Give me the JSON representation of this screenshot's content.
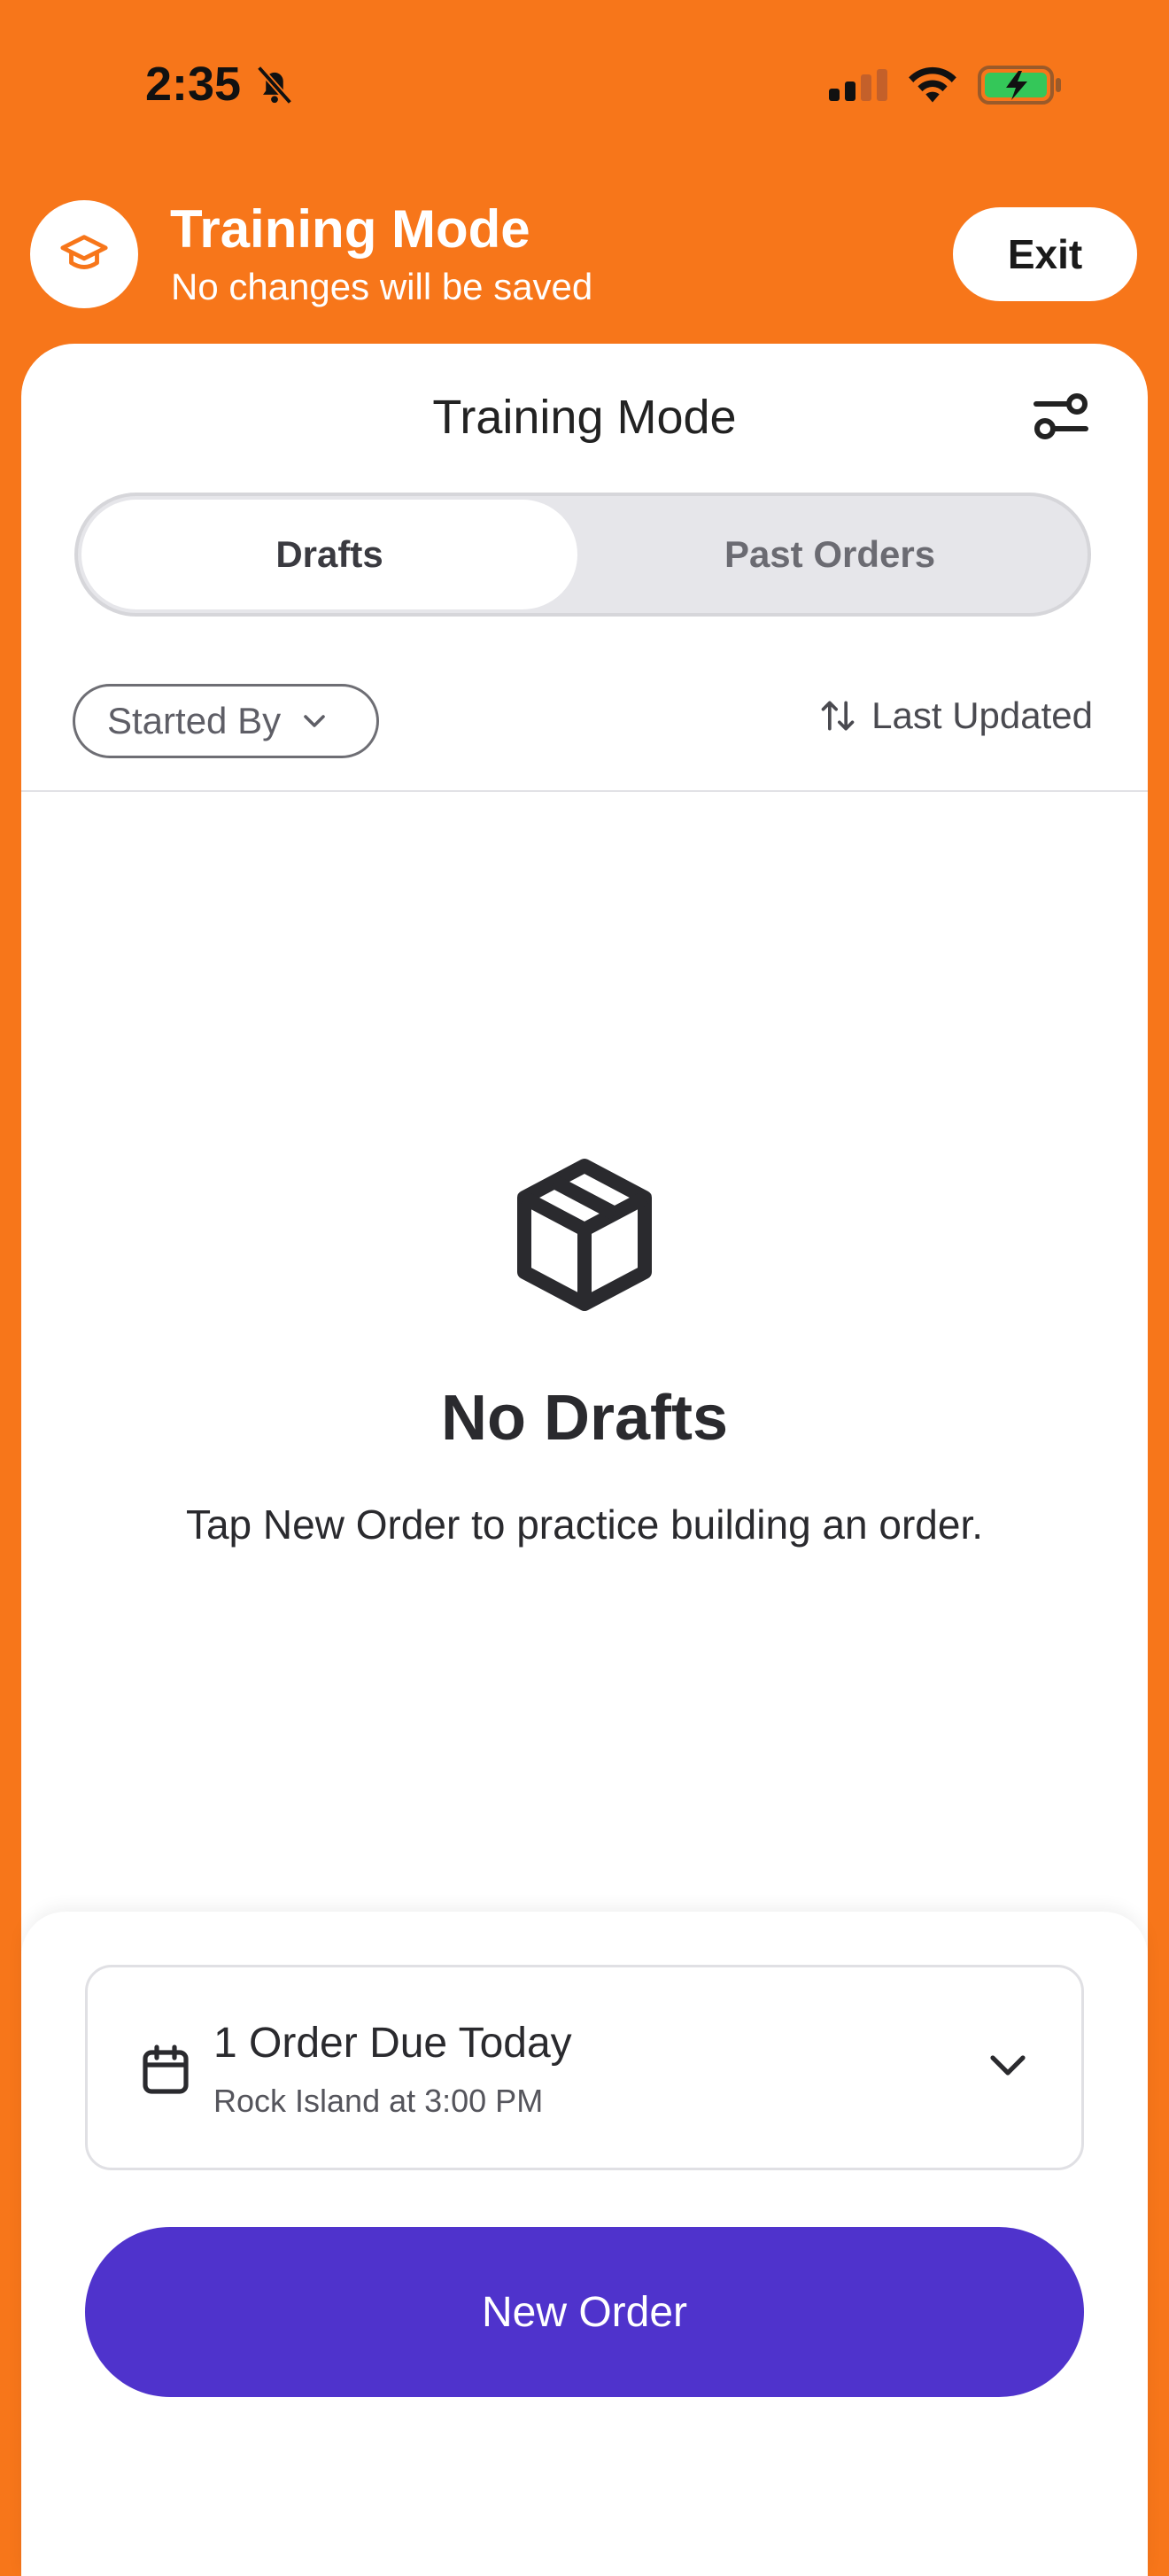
{
  "status_bar": {
    "time": "2:35"
  },
  "banner": {
    "title": "Training Mode",
    "subtitle": "No changes will be saved",
    "exit_label": "Exit"
  },
  "sheet": {
    "title": "Training Mode",
    "tabs": [
      {
        "label": "Drafts",
        "selected": true
      },
      {
        "label": "Past Orders",
        "selected": false
      }
    ],
    "filter_label": "Started By",
    "sort_label": "Last Updated",
    "empty_state": {
      "title": "No Drafts",
      "message": "Tap New Order to practice building an order."
    }
  },
  "bottom": {
    "due_title": "1 Order Due Today",
    "due_subtitle": "Rock Island at 3:00 PM",
    "new_order_label": "New Order"
  },
  "colors": {
    "banner_bg": "#F7761A",
    "primary_button": "#4F33CC",
    "battery_fill": "#34C759"
  },
  "icons": [
    "bell-slash-icon",
    "cellular-signal-icon",
    "wifi-icon",
    "battery-charging-icon",
    "graduation-cap-icon",
    "filter-sliders-icon",
    "chevron-down-icon",
    "sort-arrows-icon",
    "package-box-icon",
    "calendar-icon"
  ]
}
